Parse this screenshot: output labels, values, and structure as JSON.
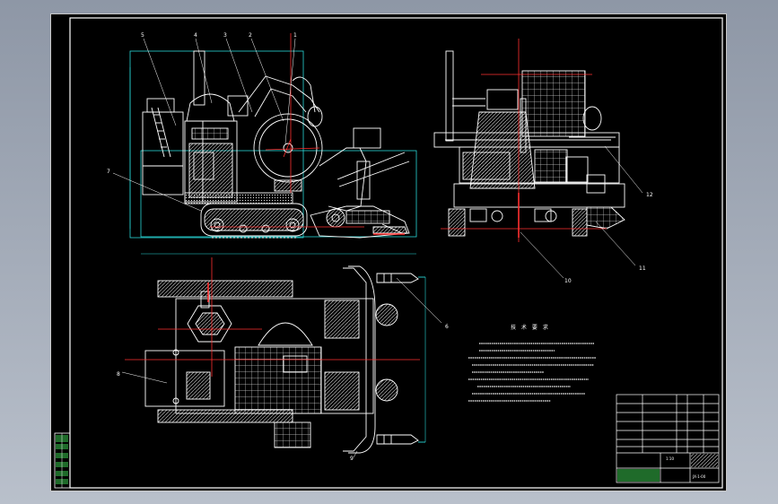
{
  "drawing": {
    "callouts": {
      "c1": "1",
      "c2": "2",
      "c3": "3",
      "c4": "4",
      "c5": "5",
      "c6": "6",
      "c7": "7",
      "c8": "8",
      "c9": "9",
      "c10": "10",
      "c11": "11",
      "c12": "12"
    },
    "notes_title": "技 术 要 求",
    "title_block": {
      "scale": "1:10",
      "code": "JX-1-00"
    },
    "colors": {
      "background": "#000000",
      "outline": "#ffffff",
      "centerline": "#ff3030",
      "dimension": "#28d8d8",
      "hatch": "#e0e0e0",
      "frame_outer": "#c8c8c8"
    }
  }
}
